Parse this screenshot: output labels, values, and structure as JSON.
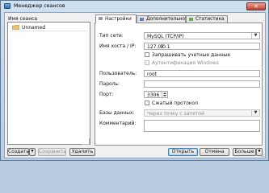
{
  "window": {
    "title": "Менеджер сеансов"
  },
  "sessions": {
    "header": "Имя сеанса",
    "items": [
      {
        "label": "Unnamed"
      }
    ]
  },
  "tabs": [
    {
      "label": "Настройки"
    },
    {
      "label": "Дополнительно"
    },
    {
      "label": "Статистика"
    }
  ],
  "form": {
    "network_type": {
      "label": "Тип сети:",
      "value": "MySQL (TCP/IP)"
    },
    "host": {
      "label": "Имя хоста / IP:",
      "value": "127.0.0.1"
    },
    "prompt_credentials": {
      "label": "Запрашивать учетные данные",
      "checked": false
    },
    "windows_auth": {
      "label": "Аутентификация Windows",
      "checked": false
    },
    "user": {
      "label": "Пользователь:",
      "value": "root"
    },
    "password": {
      "label": "Пароль:",
      "value": ""
    },
    "port": {
      "label": "Порт:",
      "value": "3306"
    },
    "compressed": {
      "label": "Сжатый протокол",
      "checked": false
    },
    "databases": {
      "label": "Базы данных:",
      "placeholder": "Через точку с запятой"
    },
    "comment": {
      "label": "Комментарий:",
      "value": ""
    }
  },
  "buttons": {
    "create": "Создать",
    "save": "Сохранить",
    "delete": "Удалить",
    "open": "Открыть",
    "cancel": "Отмена",
    "more": "Больше"
  },
  "colors": {
    "accent": "#3c7fb1",
    "title_bar": "#b7cde3",
    "close_button": "#c4412e"
  }
}
